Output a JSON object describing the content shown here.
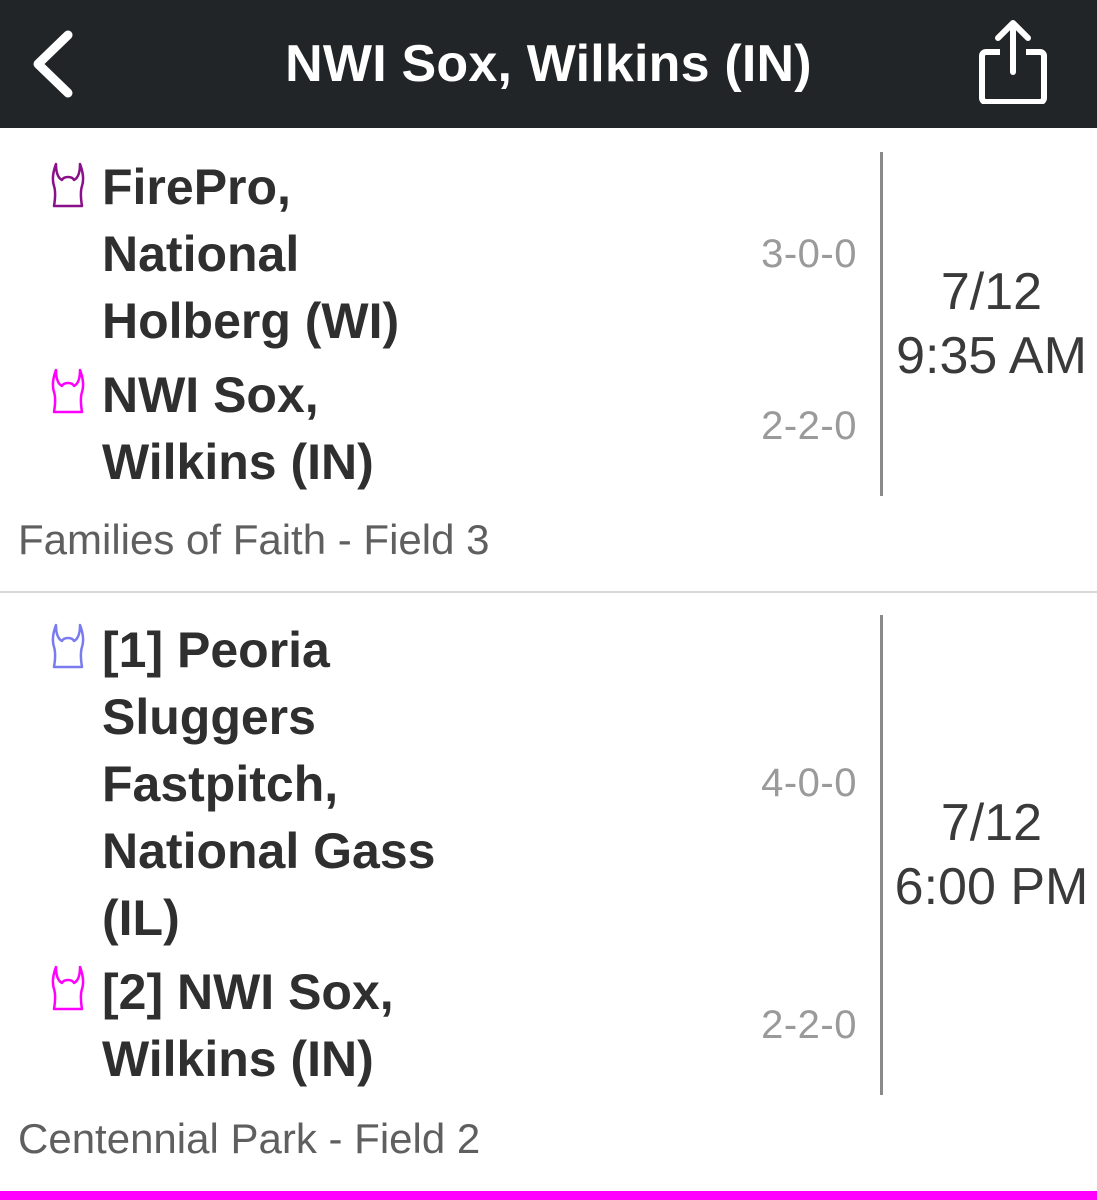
{
  "header": {
    "title": "NWI Sox, Wilkins (IN)",
    "back_icon": "chevron-left-icon",
    "share_icon": "share-icon",
    "background": "#212528"
  },
  "games": [
    {
      "home": {
        "name_lines": [
          "FirePro,",
          "National",
          "Holberg (WI)"
        ],
        "record": "3-0-0",
        "jersey_color": "#8a0f8a"
      },
      "away": {
        "name_lines": [
          "NWI Sox,",
          "Wilkins (IN)"
        ],
        "record": "2-2-0",
        "jersey_color": "#ff00ff"
      },
      "date": "7/12",
      "time": "9:35 AM",
      "location": "Families of Faith - Field 3"
    },
    {
      "home": {
        "name_lines": [
          "[1] Peoria",
          "Sluggers",
          "Fastpitch,",
          "National Gass",
          "(IL)"
        ],
        "record": "4-0-0",
        "jersey_color": "#7b7bf0"
      },
      "away": {
        "name_lines": [
          "[2] NWI Sox,",
          "Wilkins (IN)"
        ],
        "record": "2-2-0",
        "jersey_color": "#ff00ff"
      },
      "date": "7/12",
      "time": "6:00 PM",
      "location": "Centennial Park - Field 2"
    }
  ],
  "accent_color": "#ff00ff"
}
